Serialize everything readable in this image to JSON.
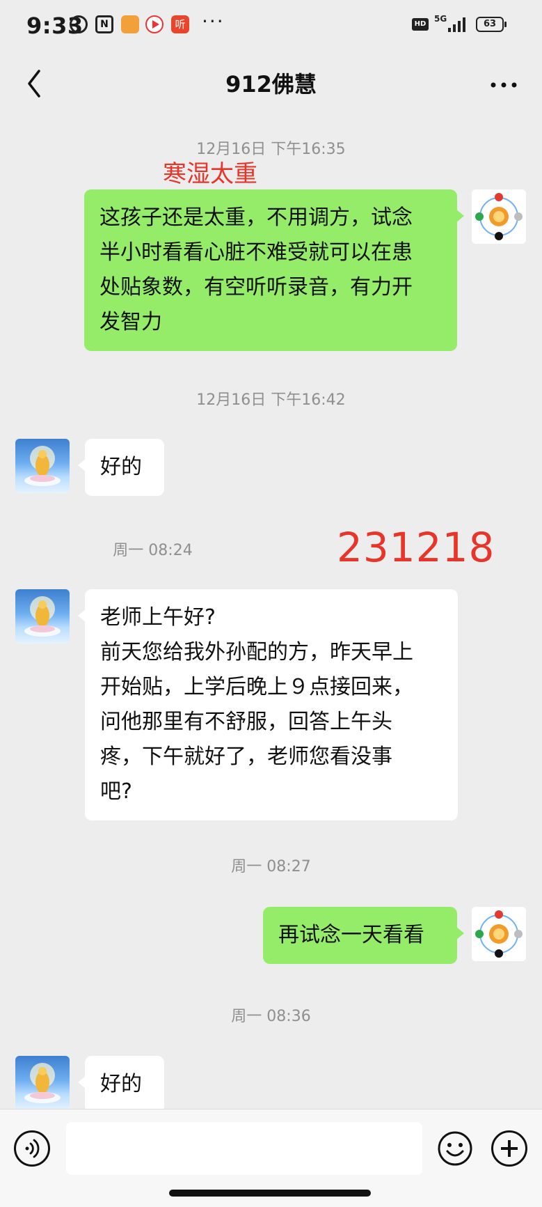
{
  "status_bar": {
    "time": "9:33",
    "battery": "63",
    "network": "5G",
    "hd_badge": "HD",
    "app3_label": "听",
    "overflow": "···"
  },
  "header": {
    "title": "912佛慧",
    "back_icon": "chevron-left-icon",
    "more_icon": "more-icon"
  },
  "annotations": {
    "top_red": "寒湿太重",
    "date_red": "231218"
  },
  "messages": [
    {
      "type": "timestamp",
      "text": "12月16日 下午16:35"
    },
    {
      "type": "bubble",
      "sender": "me",
      "text": "这孩子还是太重，不用调方，试念\n半小时看看心脏不难受就可以在患\n处贴象数，有空听听录音，有力开\n发智力"
    },
    {
      "type": "timestamp",
      "text": "12月16日 下午16:42"
    },
    {
      "type": "bubble",
      "sender": "them",
      "text": "好的"
    },
    {
      "type": "timestamp",
      "text": "周一 08:24"
    },
    {
      "type": "bubble",
      "sender": "them",
      "text": "老师上午好?\n前天您给我外孙配的方，昨天早上\n开始贴，上学后晚上９点接回来，\n问他那里有不舒服，回答上午头\n疼，下午就好了，老师您看没事\n吧?"
    },
    {
      "type": "timestamp",
      "text": "周一 08:27"
    },
    {
      "type": "bubble",
      "sender": "me",
      "text": "再试念一天看看"
    },
    {
      "type": "timestamp",
      "text": "周一 08:36"
    },
    {
      "type": "bubble",
      "sender": "them",
      "text": "好的"
    }
  ],
  "input_bar": {
    "voice_icon": "voice-icon",
    "emoji_icon": "emoji-icon",
    "plus_icon": "plus-icon",
    "placeholder": ""
  },
  "colors": {
    "background": "#ededed",
    "my_bubble": "#95ec69",
    "their_bubble": "#ffffff",
    "annotation": "#e8352a",
    "timestamp": "#8f8f8f"
  }
}
